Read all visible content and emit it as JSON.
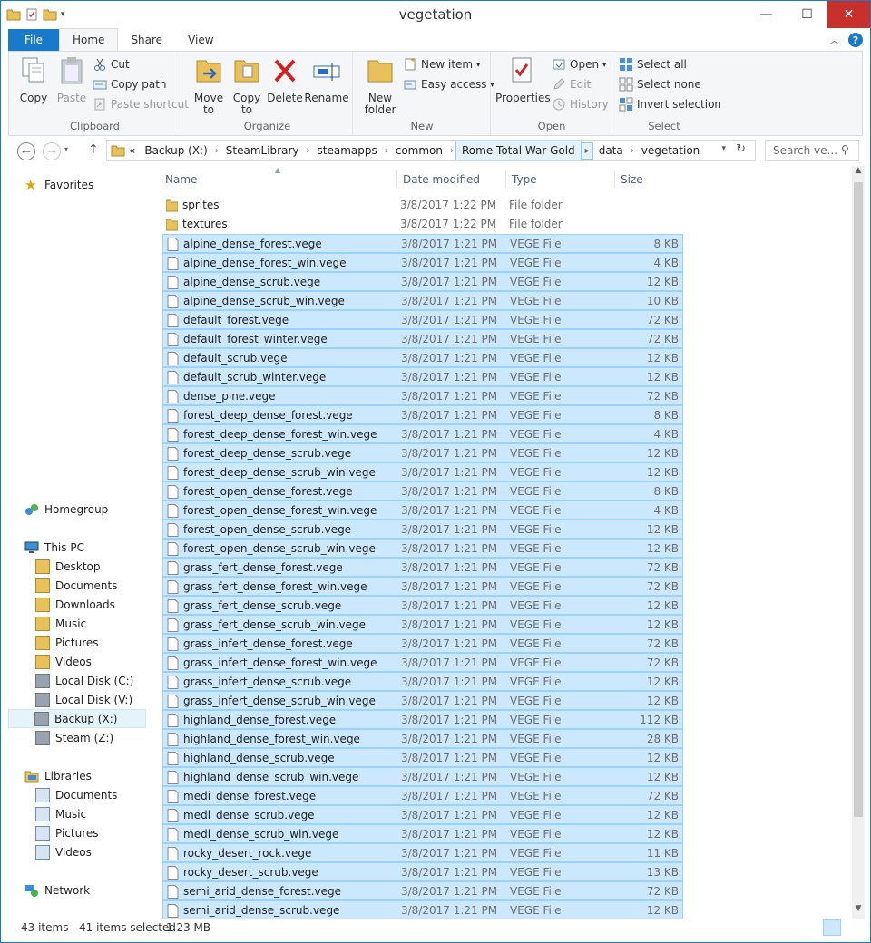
{
  "window": {
    "title": "vegetation"
  },
  "ribbon_tabs": {
    "file": "File",
    "home": "Home",
    "share": "Share",
    "view": "View"
  },
  "ribbon": {
    "copy": "Copy",
    "paste": "Paste",
    "cut": "Cut",
    "copy_path": "Copy path",
    "paste_shortcut": "Paste shortcut",
    "clipboard": "Clipboard",
    "move_to": "Move\nto",
    "copy_to": "Copy\nto",
    "delete": "Delete",
    "rename": "Rename",
    "organize": "Organize",
    "new_folder": "New\nfolder",
    "new_item": "New item",
    "easy_access": "Easy access",
    "new_group": "New",
    "properties": "Properties",
    "open": "Open",
    "edit": "Edit",
    "history": "History",
    "open_group": "Open",
    "select_all": "Select all",
    "select_none": "Select none",
    "invert_selection": "Invert selection",
    "select_group": "Select"
  },
  "address": {
    "crumbs": [
      "«",
      "Backup  (X:)",
      "SteamLibrary",
      "steamapps",
      "common",
      "Rome Total War Gold",
      "data",
      "vegetation"
    ],
    "search_placeholder": "Search ve..."
  },
  "nav": {
    "favorites": "Favorites",
    "homegroup": "Homegroup",
    "this_pc": "This PC",
    "pc_items": [
      "Desktop",
      "Documents",
      "Downloads",
      "Music",
      "Pictures",
      "Videos",
      "Local Disk (C:)",
      "Local Disk (V:)",
      "Backup  (X:)",
      "Steam (Z:)"
    ],
    "libraries": "Libraries",
    "lib_items": [
      "Documents",
      "Music",
      "Pictures",
      "Videos"
    ],
    "network": "Network"
  },
  "columns": {
    "name": "Name",
    "date": "Date modified",
    "type": "Type",
    "size": "Size"
  },
  "files": [
    {
      "name": "sprites",
      "date": "3/8/2017 1:22 PM",
      "type": "File folder",
      "size": "",
      "folder": true
    },
    {
      "name": "textures",
      "date": "3/8/2017 1:22 PM",
      "type": "File folder",
      "size": "",
      "folder": true
    },
    {
      "name": "alpine_dense_forest.vege",
      "date": "3/8/2017 1:21 PM",
      "type": "VEGE File",
      "size": "8 KB"
    },
    {
      "name": "alpine_dense_forest_win.vege",
      "date": "3/8/2017 1:21 PM",
      "type": "VEGE File",
      "size": "4 KB"
    },
    {
      "name": "alpine_dense_scrub.vege",
      "date": "3/8/2017 1:21 PM",
      "type": "VEGE File",
      "size": "12 KB"
    },
    {
      "name": "alpine_dense_scrub_win.vege",
      "date": "3/8/2017 1:21 PM",
      "type": "VEGE File",
      "size": "10 KB"
    },
    {
      "name": "default_forest.vege",
      "date": "3/8/2017 1:21 PM",
      "type": "VEGE File",
      "size": "72 KB"
    },
    {
      "name": "default_forest_winter.vege",
      "date": "3/8/2017 1:21 PM",
      "type": "VEGE File",
      "size": "72 KB"
    },
    {
      "name": "default_scrub.vege",
      "date": "3/8/2017 1:21 PM",
      "type": "VEGE File",
      "size": "12 KB"
    },
    {
      "name": "default_scrub_winter.vege",
      "date": "3/8/2017 1:21 PM",
      "type": "VEGE File",
      "size": "12 KB"
    },
    {
      "name": "dense_pine.vege",
      "date": "3/8/2017 1:21 PM",
      "type": "VEGE File",
      "size": "72 KB"
    },
    {
      "name": "forest_deep_dense_forest.vege",
      "date": "3/8/2017 1:21 PM",
      "type": "VEGE File",
      "size": "8 KB"
    },
    {
      "name": "forest_deep_dense_forest_win.vege",
      "date": "3/8/2017 1:21 PM",
      "type": "VEGE File",
      "size": "4 KB"
    },
    {
      "name": "forest_deep_dense_scrub.vege",
      "date": "3/8/2017 1:21 PM",
      "type": "VEGE File",
      "size": "12 KB"
    },
    {
      "name": "forest_deep_dense_scrub_win.vege",
      "date": "3/8/2017 1:21 PM",
      "type": "VEGE File",
      "size": "12 KB"
    },
    {
      "name": "forest_open_dense_forest.vege",
      "date": "3/8/2017 1:21 PM",
      "type": "VEGE File",
      "size": "8 KB"
    },
    {
      "name": "forest_open_dense_forest_win.vege",
      "date": "3/8/2017 1:21 PM",
      "type": "VEGE File",
      "size": "4 KB"
    },
    {
      "name": "forest_open_dense_scrub.vege",
      "date": "3/8/2017 1:21 PM",
      "type": "VEGE File",
      "size": "12 KB"
    },
    {
      "name": "forest_open_dense_scrub_win.vege",
      "date": "3/8/2017 1:21 PM",
      "type": "VEGE File",
      "size": "12 KB"
    },
    {
      "name": "grass_fert_dense_forest.vege",
      "date": "3/8/2017 1:21 PM",
      "type": "VEGE File",
      "size": "72 KB"
    },
    {
      "name": "grass_fert_dense_forest_win.vege",
      "date": "3/8/2017 1:21 PM",
      "type": "VEGE File",
      "size": "72 KB"
    },
    {
      "name": "grass_fert_dense_scrub.vege",
      "date": "3/8/2017 1:21 PM",
      "type": "VEGE File",
      "size": "12 KB"
    },
    {
      "name": "grass_fert_dense_scrub_win.vege",
      "date": "3/8/2017 1:21 PM",
      "type": "VEGE File",
      "size": "12 KB"
    },
    {
      "name": "grass_infert_dense_forest.vege",
      "date": "3/8/2017 1:21 PM",
      "type": "VEGE File",
      "size": "72 KB"
    },
    {
      "name": "grass_infert_dense_forest_win.vege",
      "date": "3/8/2017 1:21 PM",
      "type": "VEGE File",
      "size": "72 KB"
    },
    {
      "name": "grass_infert_dense_scrub.vege",
      "date": "3/8/2017 1:21 PM",
      "type": "VEGE File",
      "size": "12 KB"
    },
    {
      "name": "grass_infert_dense_scrub_win.vege",
      "date": "3/8/2017 1:21 PM",
      "type": "VEGE File",
      "size": "12 KB"
    },
    {
      "name": "highland_dense_forest.vege",
      "date": "3/8/2017 1:21 PM",
      "type": "VEGE File",
      "size": "112 KB"
    },
    {
      "name": "highland_dense_forest_win.vege",
      "date": "3/8/2017 1:21 PM",
      "type": "VEGE File",
      "size": "28 KB"
    },
    {
      "name": "highland_dense_scrub.vege",
      "date": "3/8/2017 1:21 PM",
      "type": "VEGE File",
      "size": "12 KB"
    },
    {
      "name": "highland_dense_scrub_win.vege",
      "date": "3/8/2017 1:21 PM",
      "type": "VEGE File",
      "size": "12 KB"
    },
    {
      "name": "medi_dense_forest.vege",
      "date": "3/8/2017 1:21 PM",
      "type": "VEGE File",
      "size": "72 KB"
    },
    {
      "name": "medi_dense_scrub.vege",
      "date": "3/8/2017 1:21 PM",
      "type": "VEGE File",
      "size": "12 KB"
    },
    {
      "name": "medi_dense_scrub_win.vege",
      "date": "3/8/2017 1:21 PM",
      "type": "VEGE File",
      "size": "12 KB"
    },
    {
      "name": "rocky_desert_rock.vege",
      "date": "3/8/2017 1:21 PM",
      "type": "VEGE File",
      "size": "11 KB"
    },
    {
      "name": "rocky_desert_scrub.vege",
      "date": "3/8/2017 1:21 PM",
      "type": "VEGE File",
      "size": "13 KB"
    },
    {
      "name": "semi_arid_dense_forest.vege",
      "date": "3/8/2017 1:21 PM",
      "type": "VEGE File",
      "size": "72 KB"
    },
    {
      "name": "semi_arid_dense_scrub.vege",
      "date": "3/8/2017 1:21 PM",
      "type": "VEGE File",
      "size": "12 KB"
    }
  ],
  "status": {
    "items": "43 items",
    "selected": "41 items selected",
    "size": "1.23 MB"
  },
  "colors": {
    "accent": "#1979ca",
    "selection": "#cce8ff",
    "selection_border": "#99d1ff",
    "close": "#c7302b"
  }
}
